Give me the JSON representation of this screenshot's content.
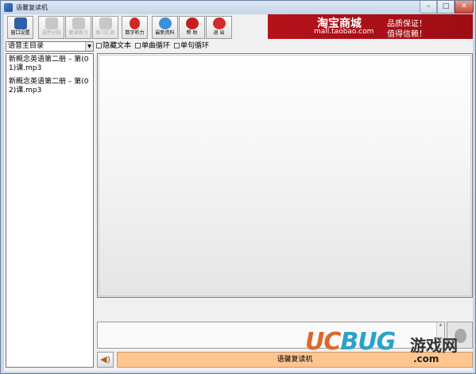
{
  "window": {
    "title": "语馨复读机",
    "controls": {
      "minimize": "–",
      "maximize": "□",
      "close": "✕"
    }
  },
  "toolbar": {
    "buttons": [
      {
        "label": "窗口设置",
        "icon": "window-settings-icon",
        "enabled": true,
        "color": "#2e5fa8"
      },
      {
        "label": "语音分段",
        "icon": "audio-segment-icon",
        "enabled": false,
        "color": "#c7c7c7"
      },
      {
        "label": "复读练习",
        "icon": "repeat-practice-icon",
        "enabled": false,
        "color": "#c7c7c7"
      },
      {
        "label": "练习汇总",
        "icon": "practice-summary-icon",
        "enabled": false,
        "color": "#c7c7c7"
      },
      {
        "label": "数字听力",
        "icon": "digit-listening-icon",
        "enabled": true,
        "color": "#d32626"
      },
      {
        "label": "最新资料",
        "icon": "latest-materials-icon",
        "enabled": true,
        "color": "#3f8fd9"
      },
      {
        "label": "帮 助",
        "icon": "help-icon",
        "enabled": true,
        "color": "#c81e1e"
      },
      {
        "label": "退 出",
        "icon": "exit-icon",
        "enabled": true,
        "color": "#d42a2a"
      }
    ]
  },
  "banner": {
    "title": "淘宝商城",
    "url": "mall.taobao.com",
    "line1": "品质保证！",
    "line2": "值得信赖！"
  },
  "options": {
    "directory_select": "语音主目录",
    "hide_text": "隐藏文本",
    "single_track_loop": "单曲循环",
    "single_sentence_loop": "单句循环"
  },
  "files": [
    "新概念英语第二册 – 第(01)课.mp3",
    "新概念英语第二册 – 第(02)课.mp3"
  ],
  "status": {
    "text": "语馨复读机"
  },
  "watermark": {
    "brand_a": "UC",
    "brand_b": "BUG",
    "cn": "游戏网",
    "domain": ".com"
  }
}
